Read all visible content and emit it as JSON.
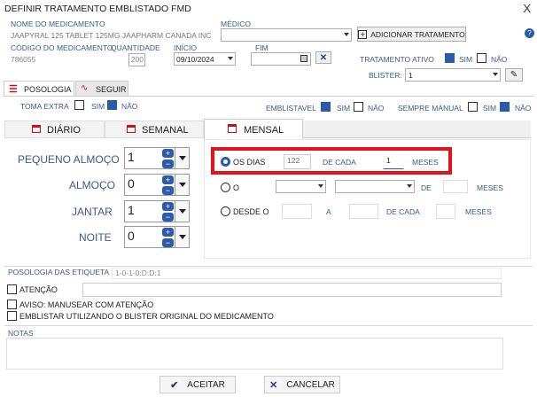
{
  "window": {
    "title": "DEFINIR TRATAMENTO EMBLISTADO FMD",
    "close": "X"
  },
  "med": {
    "name_label": "NOME DO MEDICAMENTO",
    "name_value": "JAAPYRAL 125 TABLET 125MG JAAPHARM CANADA INC",
    "code_label": "CÓDIGO DO MEDICAMENTO",
    "code_value": "786055",
    "qty_label": "QUANTIDADE",
    "qty_value": "200"
  },
  "medico": {
    "label": "MÉDICO",
    "value": "",
    "add_button": "ADICIONAR TRATAMENTO"
  },
  "dates": {
    "inicio_label": "INÍCIO",
    "inicio_value": "09/10/2024",
    "fim_label": "FIM",
    "fim_value": ""
  },
  "tratamento": {
    "label": "TRATAMENTO ATIVO",
    "sim": "SIM",
    "nao": "NÃO",
    "sim_checked": true,
    "nao_checked": false
  },
  "blister": {
    "label": "BLISTER:",
    "value": "1"
  },
  "tabs": {
    "posologia": "POSOLOGIA",
    "seguir": "SEGUIR"
  },
  "toma_extra": {
    "label": "TOMA EXTRA",
    "sim": "SIM",
    "nao": "NÃO",
    "sim_checked": false,
    "nao_checked": true
  },
  "emblistavel": {
    "label": "EMBLISTAVEL",
    "sim": "SIM",
    "nao": "NÃO",
    "sim_checked": true,
    "nao_checked": false
  },
  "sempre_manual": {
    "label": "SEMPRE MANUAL",
    "sim": "SIM",
    "nao": "NÃO",
    "sim_checked": false,
    "nao_checked": true
  },
  "freq_tabs": {
    "diario": "DIÁRIO",
    "semanal": "SEMANAL",
    "mensal": "MENSAL"
  },
  "doses": [
    {
      "label": "PEQUENO ALMOÇO",
      "value": "1"
    },
    {
      "label": "ALMOÇO",
      "value": "0"
    },
    {
      "label": "JANTAR",
      "value": "1"
    },
    {
      "label": "NOITE",
      "value": "0"
    }
  ],
  "mensal": {
    "os_dias_label": "OS DIAS",
    "os_dias_value": "122",
    "de_cada_label": "DE CADA",
    "de_cada_value": "1",
    "meses_label": "MESES",
    "o_label": "O",
    "o_de": "DE",
    "o_meses": "MESES",
    "desde_label": "DESDE O",
    "desde_a": "A",
    "desde_de_cada": "DE CADA",
    "desde_meses": "MESES"
  },
  "etiquetas": {
    "label": "POSOLOGIA DAS ETIQUETA",
    "value": "1-0-1-0:D:D:1"
  },
  "atencao": {
    "label": "ATENÇÃO",
    "value": ""
  },
  "aviso": {
    "label": "AVISO: MANUSEAR COM ATENÇÃO"
  },
  "emblistar_original": {
    "label": "EMBLISTAR UTILIZANDO O BLISTER ORIGINAL DO MEDICAMENTO"
  },
  "notas": {
    "label": "NOTAS",
    "value": ""
  },
  "buttons": {
    "accept": "ACEITAR",
    "cancel": "CANCELAR"
  },
  "colors": {
    "accent": "#2b5aa8",
    "highlight": "#e0141c",
    "label": "#3b5a8c"
  }
}
